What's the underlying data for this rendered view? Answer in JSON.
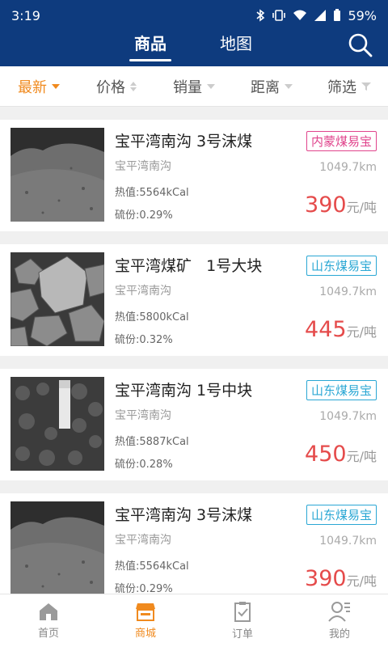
{
  "status": {
    "time": "3:19",
    "battery": "59%"
  },
  "nav": {
    "tabs": [
      "商品",
      "地图"
    ],
    "active": 0
  },
  "filters": [
    {
      "label": "最新",
      "icon": "caret-down-icon",
      "active": true
    },
    {
      "label": "价格",
      "icon": "sort-icon",
      "active": false
    },
    {
      "label": "销量",
      "icon": "caret-down-icon",
      "active": false
    },
    {
      "label": "距离",
      "icon": "caret-down-icon",
      "active": false
    },
    {
      "label": "筛选",
      "icon": "funnel-icon",
      "active": false
    }
  ],
  "products": [
    {
      "name": "宝平湾南沟 3号沫煤",
      "mine": "宝平湾南沟",
      "heat": "热值:5564kCal",
      "sulfur": "硫份:0.29%",
      "badge": "内蒙煤易宝",
      "badge_color": "#e0448c",
      "distance": "1049.7km",
      "price": "390",
      "unit": "元/吨",
      "image": "coal-fines"
    },
    {
      "name": "宝平湾煤矿   1号大块",
      "mine": "宝平湾南沟",
      "heat": "热值:5800kCal",
      "sulfur": "硫份:0.32%",
      "badge": "山东煤易宝",
      "badge_color": "#2aa7d4",
      "distance": "1049.7km",
      "price": "445",
      "unit": "元/吨",
      "image": "coal-lumps"
    },
    {
      "name": "宝平湾南沟 1号中块",
      "mine": "宝平湾南沟",
      "heat": "热值:5887kCal",
      "sulfur": "硫份:0.28%",
      "badge": "山东煤易宝",
      "badge_color": "#2aa7d4",
      "distance": "1049.7km",
      "price": "450",
      "unit": "元/吨",
      "image": "coal-medium"
    },
    {
      "name": "宝平湾南沟 3号沫煤",
      "mine": "宝平湾南沟",
      "heat": "热值:5564kCal",
      "sulfur": "硫份:0.29%",
      "badge": "山东煤易宝",
      "badge_color": "#2aa7d4",
      "distance": "1049.7km",
      "price": "390",
      "unit": "元/吨",
      "image": "coal-fines"
    }
  ],
  "tabbar": [
    {
      "label": "首页",
      "icon": "home-icon",
      "active": false
    },
    {
      "label": "商城",
      "icon": "store-icon",
      "active": true
    },
    {
      "label": "订单",
      "icon": "order-icon",
      "active": false
    },
    {
      "label": "我的",
      "icon": "profile-icon",
      "active": false
    }
  ]
}
